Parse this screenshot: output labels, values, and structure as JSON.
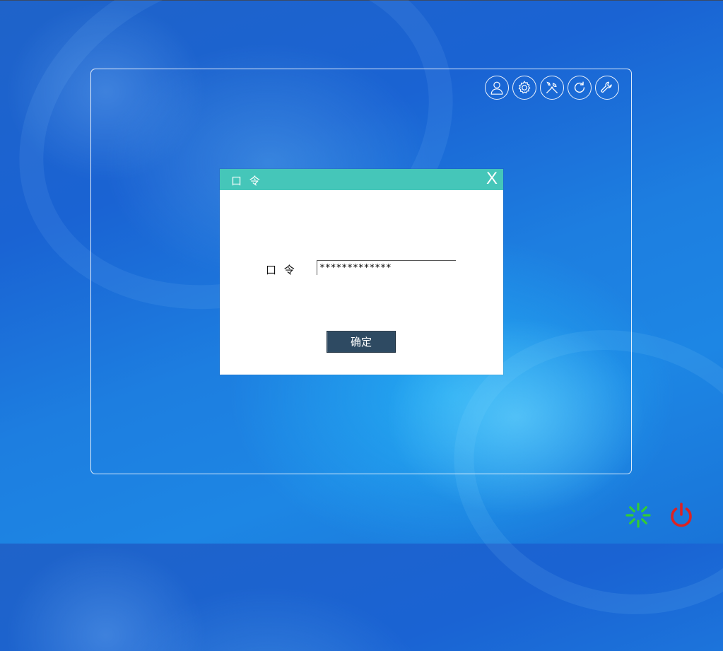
{
  "toolbar": {
    "icons": [
      "user-icon",
      "gear-icon",
      "tools-icon",
      "refresh-icon",
      "wrench-icon"
    ]
  },
  "dialog": {
    "title": "口 令",
    "close_label": "X",
    "password_label": "口 令",
    "password_value": "*************",
    "confirm_label": "确定"
  },
  "taskbar": {
    "icons": [
      "loading-spinner-icon",
      "power-icon"
    ]
  },
  "colors": {
    "titlebar": "#45c6b9",
    "confirm_button": "#2e4a62",
    "spinner": "#33cc33",
    "power": "#dd2222"
  }
}
